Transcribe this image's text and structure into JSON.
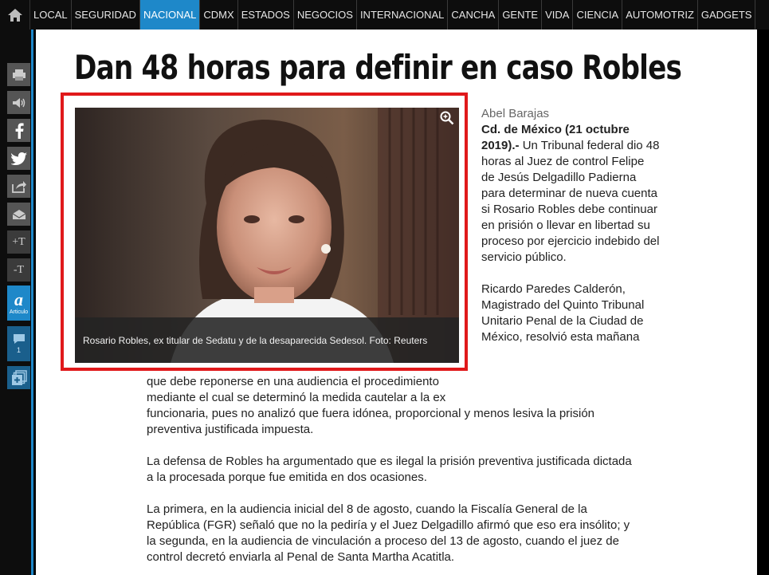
{
  "nav": {
    "items": [
      {
        "label": "LOCAL",
        "active": false
      },
      {
        "label": "SEGURIDAD",
        "active": false
      },
      {
        "label": "NACIONAL",
        "active": true
      },
      {
        "label": "CDMX",
        "active": false
      },
      {
        "label": "ESTADOS",
        "active": false
      },
      {
        "label": "NEGOCIOS",
        "active": false
      },
      {
        "label": "INTERNACIONAL",
        "active": false
      },
      {
        "label": "CANCHA",
        "active": false
      },
      {
        "label": "GENTE",
        "active": false
      },
      {
        "label": "VIDA",
        "active": false
      },
      {
        "label": "CIENCIA",
        "active": false
      },
      {
        "label": "AUTOMOTRIZ",
        "active": false
      },
      {
        "label": "GADGETS",
        "active": false
      }
    ]
  },
  "toolbar": {
    "increase_text": "+T",
    "decrease_text": "-T",
    "article_letter": "a",
    "article_label": "Articulo",
    "comments_count": "1"
  },
  "article": {
    "headline": "Dan 48 horas para definir en caso Robles",
    "photo_caption": "Rosario Robles, ex titular de Sedatu y de la desaparecida Sedesol. Foto: Reuters",
    "author": "Abel Barajas",
    "dateline": "Cd. de México (21 octubre 2019).-",
    "lead_rest": " Un Tribunal federal dio 48 horas al Juez de control Felipe de Jesús Delgadillo Padierna para determinar de nueva cuenta si Rosario Robles debe continuar en prisión o llevar en libertad su proceso por ejercicio indebido del servicio público.",
    "para2_top": "Ricardo Paredes Calderón, Magistrado del Quinto Tribunal Unitario Penal de la Ciudad de México, resolvió esta mañana",
    "para2_mid": "que debe reponerse en una audiencia el procedimiento mediante el cual se determinó la medida cautelar a la ex",
    "para2_end": "funcionaria, pues no analizó que fuera idónea, proporcional y menos lesiva la prisión preventiva justificada impuesta.",
    "para3": "La defensa de Robles ha argumentado que es ilegal la prisión preventiva justificada dictada a la procesada porque fue emitida en dos ocasiones.",
    "para4": "La primera, en la audiencia inicial del 8 de agosto, cuando la Fiscalía General de la República (FGR) señaló que no la pediría y el Juez Delgadillo afirmó que eso era insólito; y la segunda, en la audiencia de vinculación a proceso del 13 de agosto, cuando el juez de control decretó enviarla al Penal de Santa Martha Acatitla."
  },
  "colors": {
    "accent": "#1e88c9",
    "highlight_frame": "#e0191b"
  }
}
